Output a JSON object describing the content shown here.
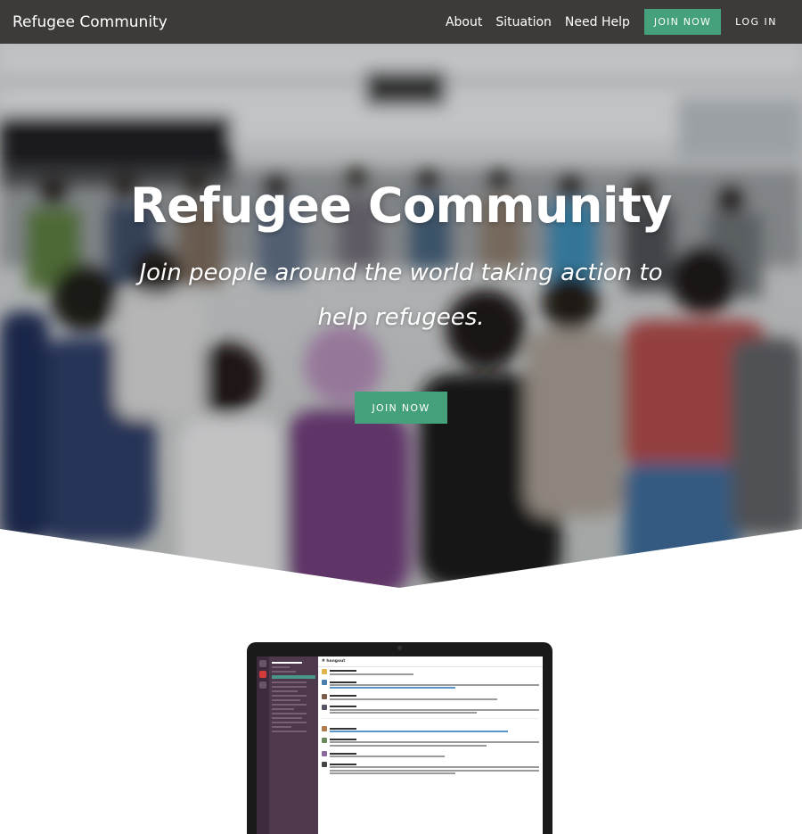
{
  "navbar": {
    "brand": "Refugee Community",
    "links": [
      "About",
      "Situation",
      "Need Help"
    ],
    "join_label": "JOIN NOW",
    "login_label": "LOG IN"
  },
  "hero": {
    "title": "Refugee Community",
    "subtitle": "Join people around the world taking action to help refugees.",
    "cta_label": "JOIN NOW"
  },
  "preview": {
    "channel": "# hangout"
  },
  "colors": {
    "navbar_bg": "#3c3b39",
    "accent_green": "#45a07c",
    "text_white": "#ffffff"
  }
}
